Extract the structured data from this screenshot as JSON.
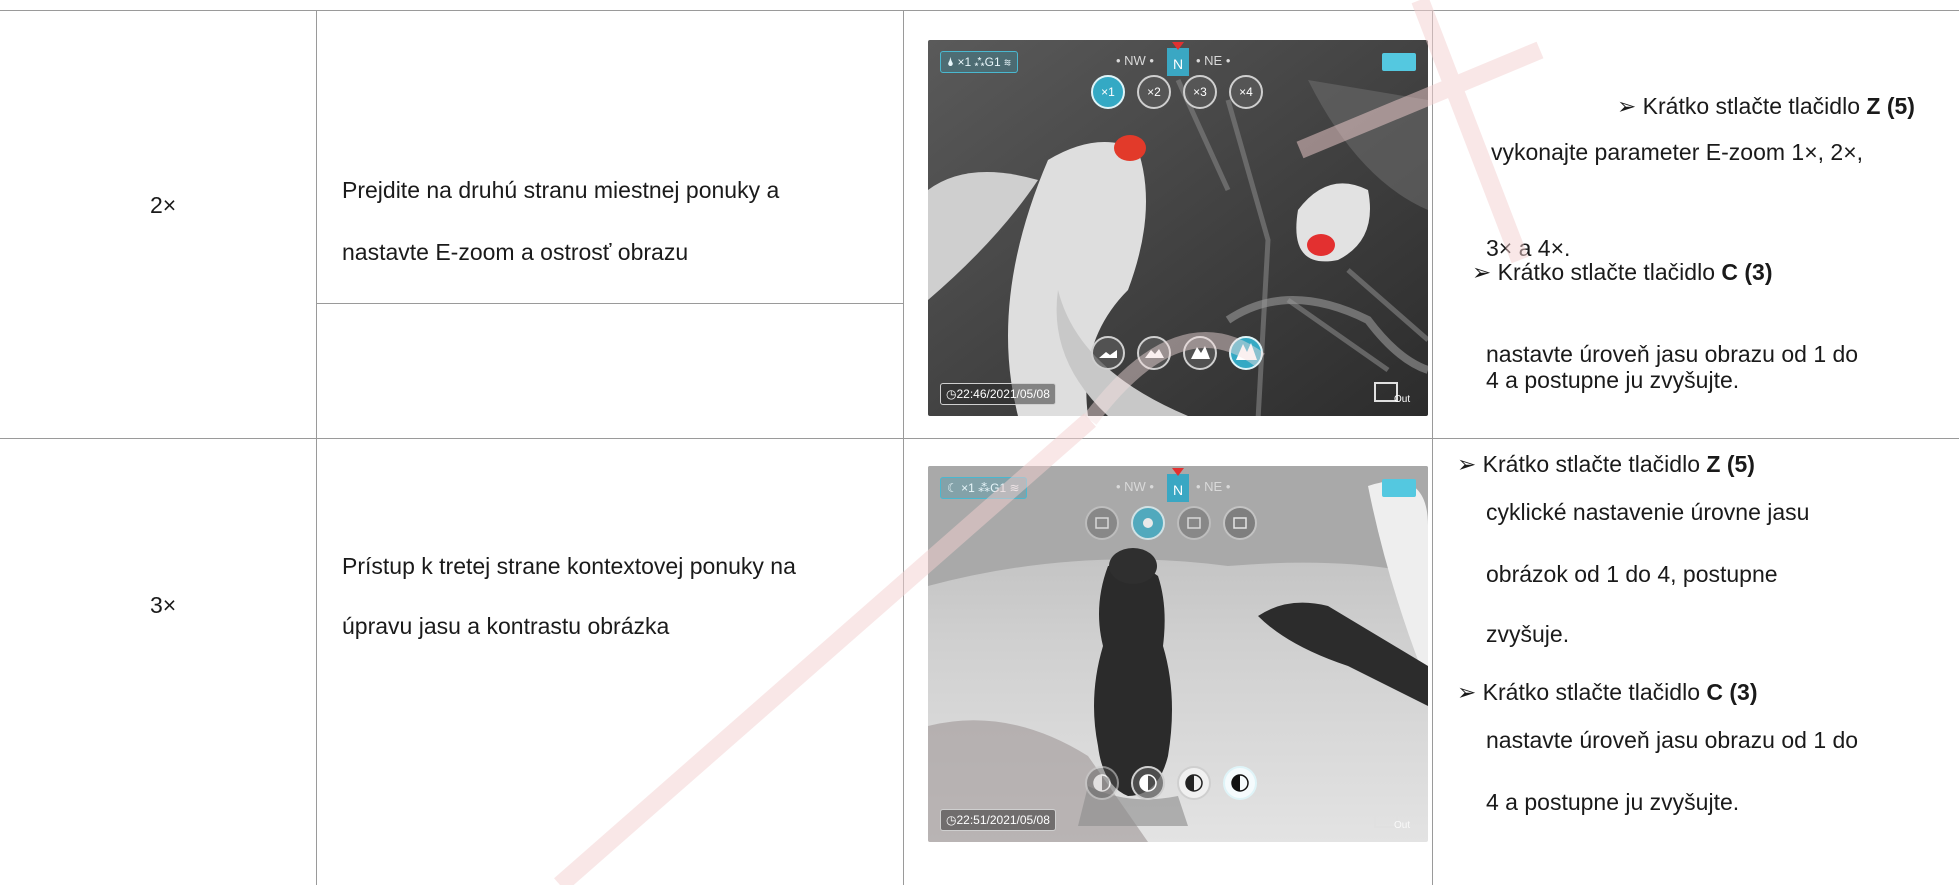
{
  "rows": [
    {
      "count": "2×",
      "action_lines": [
        "Prejdite na druhú stranu miestnej ponuky a",
        "nastavte E-zoom a ostrosť obrazu"
      ],
      "screen": {
        "topbar": "🌢 ×1  ⁂G1  ≋",
        "compass_left": "• NW •",
        "compass_n": "N",
        "compass_right": "• NE •",
        "top_icons": [
          "×1",
          "×2",
          "×3",
          "×4"
        ],
        "top_selected": 0,
        "bottom_icons": [
          "mountain-low-icon",
          "mountain-mid-icon",
          "mountain-high-icon",
          "mountain-max-icon"
        ],
        "bottom_selected": 3,
        "timestamp": "22:46/2021/05/08",
        "video_label": "Out"
      },
      "desc": [
        {
          "prefix": "➢ Krátko stlačte tlačidlo ",
          "bold": "Z (5)"
        },
        {
          "text": "vykonajte parameter E-zoom 1×, 2×,"
        },
        {
          "text": "3× a 4×."
        },
        {
          "prefix": "➢ Krátko stlačte tlačidlo ",
          "bold": "C (3)"
        },
        {
          "text": "nastavte úroveň jasu obrazu od 1 do"
        },
        {
          "text": "4 a postupne ju zvyšujte."
        }
      ]
    },
    {
      "count": "3×",
      "action_lines": [
        "Prístup k tretej strane kontextovej ponuky na",
        "úpravu jasu a kontrastu obrázka"
      ],
      "screen": {
        "topbar": "☾ ×1  ⁂G1  ≋",
        "compass_left": "• NW •",
        "compass_n": "N",
        "compass_right": "• NE •",
        "top_icons": [
          "brightness-1-icon",
          "brightness-2-icon",
          "brightness-3-icon",
          "brightness-4-icon"
        ],
        "top_selected": 1,
        "bottom_icons": [
          "contrast-1-icon",
          "contrast-2-icon",
          "contrast-3-icon",
          "contrast-4-icon"
        ],
        "bottom_selected": 3,
        "timestamp": "22:51/2021/05/08",
        "video_label": "Out"
      },
      "desc": [
        {
          "prefix": "➢ Krátko stlačte tlačidlo ",
          "bold": "Z (5)"
        },
        {
          "text": "cyklické nastavenie úrovne jasu"
        },
        {
          "text": "obrázok od 1 do 4, postupne"
        },
        {
          "text": "zvyšuje."
        },
        {
          "prefix": "➢ Krátko stlačte tlačidlo ",
          "bold": "C (3)"
        },
        {
          "text": "nastavte úroveň jasu obrazu od 1 do"
        },
        {
          "text": "4 a postupne ju zvyšujte."
        }
      ]
    }
  ]
}
